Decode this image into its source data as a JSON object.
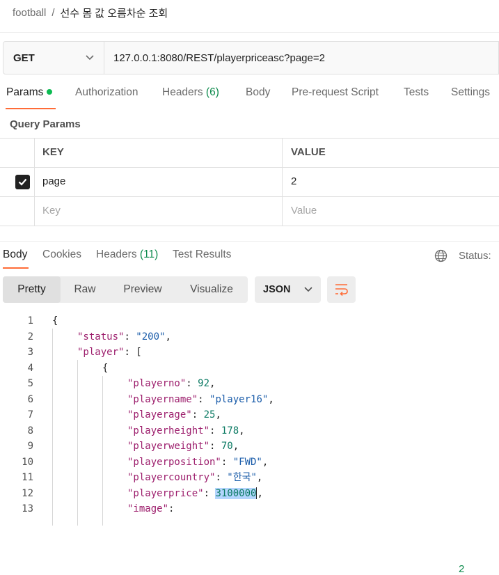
{
  "breadcrumb": {
    "parent": "football",
    "separator": "/",
    "title": "선수 몸 값 오름차순 조회"
  },
  "request": {
    "method": "GET",
    "url": "127.0.0.1:8080/REST/playerpriceasc?page=2"
  },
  "request_tabs": [
    {
      "label": "Params",
      "count": ""
    },
    {
      "label": "Authorization",
      "count": ""
    },
    {
      "label": "Headers",
      "count": "(6)"
    },
    {
      "label": "Body",
      "count": ""
    },
    {
      "label": "Pre-request Script",
      "count": ""
    },
    {
      "label": "Tests",
      "count": ""
    },
    {
      "label": "Settings",
      "count": ""
    }
  ],
  "query_params": {
    "title": "Query Params",
    "headers": {
      "key": "KEY",
      "value": "VALUE"
    },
    "rows": [
      {
        "key": "page",
        "value": "2",
        "checked": true
      }
    ],
    "placeholder": {
      "key": "Key",
      "value": "Value"
    }
  },
  "response_tabs": [
    {
      "label": "Body",
      "count": ""
    },
    {
      "label": "Cookies",
      "count": ""
    },
    {
      "label": "Headers",
      "count": "(11)"
    },
    {
      "label": "Test Results",
      "count": ""
    }
  ],
  "status": {
    "label": "Status:",
    "code": "2"
  },
  "view_modes": [
    "Pretty",
    "Raw",
    "Preview",
    "Visualize"
  ],
  "format": "JSON",
  "code_lines": [
    "1",
    "2",
    "3",
    "4",
    "5",
    "6",
    "7",
    "8",
    "9",
    "10",
    "11",
    "12",
    "13"
  ],
  "json": {
    "k_status": "\"status\"",
    "v_status": "\"200\"",
    "k_player": "\"player\"",
    "k_playerno": "\"playerno\"",
    "v_playerno": "92",
    "k_playername": "\"playername\"",
    "v_playername": "\"player16\"",
    "k_playerage": "\"playerage\"",
    "v_playerage": "25",
    "k_playerheight": "\"playerheight\"",
    "v_playerheight": "178",
    "k_playerweight": "\"playerweight\"",
    "v_playerweight": "70",
    "k_playerposition": "\"playerposition\"",
    "v_playerposition": "\"FWD\"",
    "k_playercountry": "\"playercountry\"",
    "v_playercountry": "\"한국\"",
    "k_playerprice": "\"playerprice\"",
    "v_playerprice": "3100000",
    "k_image": "\"image\""
  },
  "colors": {
    "accent": "#ff6c37",
    "success": "#0c8a4c",
    "dot": "#0cbb52"
  }
}
